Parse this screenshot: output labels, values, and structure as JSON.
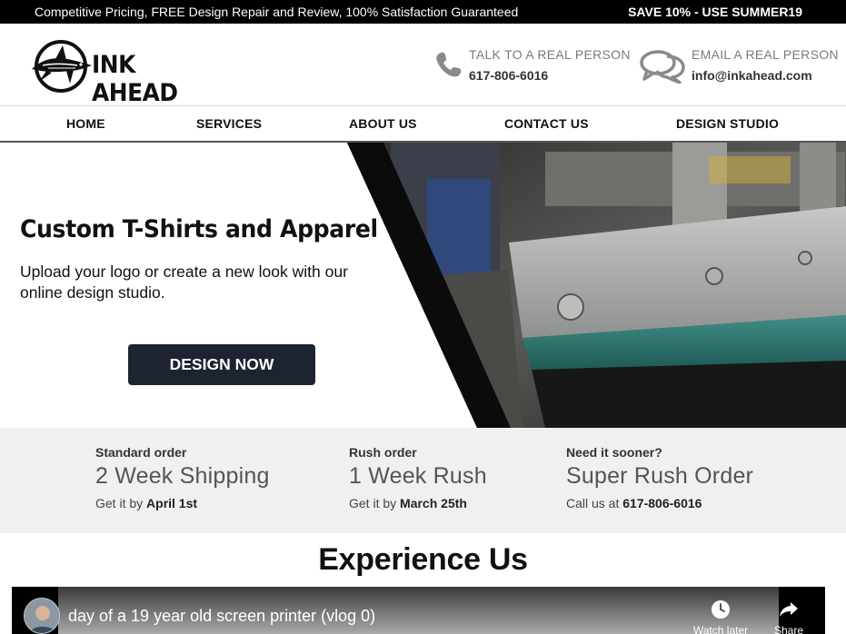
{
  "promo": {
    "left_text": "Competitive Pricing, FREE Design Repair and Review, 100% Satisfaction Guaranteed",
    "right_text": "SAVE 10% - USE SUMMER19"
  },
  "header": {
    "logo_text": "INK AHEAD",
    "phone": {
      "label": "TALK TO A REAL PERSON",
      "value": "617-806-6016",
      "icon": "phone-icon"
    },
    "email": {
      "label": "EMAIL A REAL PERSON",
      "value": "info@inkahead.com",
      "icon": "chat-bubbles-icon"
    }
  },
  "nav": {
    "items": [
      {
        "label": "HOME"
      },
      {
        "label": "SERVICES"
      },
      {
        "label": "ABOUT US"
      },
      {
        "label": "CONTACT US"
      },
      {
        "label": "DESIGN STUDIO"
      }
    ]
  },
  "hero": {
    "title": "Custom T-Shirts and Apparel",
    "subtitle": "Upload your logo or create a new look with our online design studio.",
    "cta_label": "DESIGN NOW"
  },
  "shipping": [
    {
      "label": "Standard order",
      "title": "2 Week Shipping",
      "sub_prefix": "Get it by ",
      "sub_bold": "April 1st"
    },
    {
      "label": "Rush order",
      "title": "1 Week Rush",
      "sub_prefix": "Get it by ",
      "sub_bold": "March 25th"
    },
    {
      "label": "Need it sooner?",
      "title": "Super Rush Order",
      "sub_prefix": "Call us at ",
      "sub_bold": "617-806-6016"
    }
  ],
  "experience": {
    "title": "Experience Us",
    "video": {
      "title": "day of a 19 year old screen printer (vlog 0)",
      "watch_later_label": "Watch later",
      "share_label": "Share"
    }
  },
  "colors": {
    "promo_bg": "#000000",
    "cta_bg": "#1d2331",
    "shipping_bg": "#f0f0f0",
    "nav_border": "#555555"
  }
}
